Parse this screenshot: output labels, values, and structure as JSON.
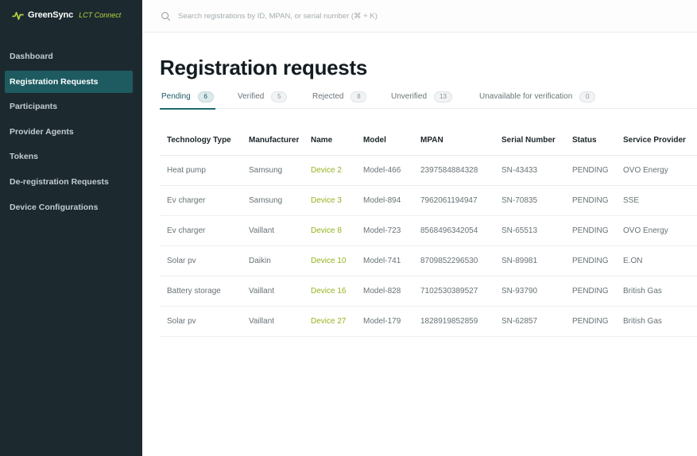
{
  "brand": {
    "name": "GreenSync",
    "product": "LCT Connect",
    "accent": "#b9d33b"
  },
  "sidebar": {
    "items": [
      {
        "label": "Dashboard",
        "active": false
      },
      {
        "label": "Registration Requests",
        "active": true
      },
      {
        "label": "Participants",
        "active": false
      },
      {
        "label": "Provider Agents",
        "active": false
      },
      {
        "label": "Tokens",
        "active": false
      },
      {
        "label": "De-registration Requests",
        "active": false
      },
      {
        "label": "Device Configurations",
        "active": false
      }
    ]
  },
  "search": {
    "placeholder": "Search registrations by ID, MPAN, or serial number (⌘ + K)",
    "value": "",
    "icon": "search-icon"
  },
  "page": {
    "title": "Registration requests"
  },
  "tabs": [
    {
      "label": "Pending",
      "count": "6",
      "active": true
    },
    {
      "label": "Verified",
      "count": "5",
      "active": false
    },
    {
      "label": "Rejected",
      "count": "8",
      "active": false
    },
    {
      "label": "Unverified",
      "count": "13",
      "active": false
    },
    {
      "label": "Unavailable for verification",
      "count": "0",
      "active": false
    }
  ],
  "table": {
    "headers": [
      "Technology Type",
      "Manufacturer",
      "Name",
      "Model",
      "MPAN",
      "Serial Number",
      "Status",
      "Service Provider"
    ],
    "rows": [
      [
        "Heat pump",
        "Samsung",
        "Device 2",
        "Model-466",
        "2397584884328",
        "SN-43433",
        "PENDING",
        "OVO Energy"
      ],
      [
        "Ev charger",
        "Samsung",
        "Device 3",
        "Model-894",
        "7962061194947",
        "SN-70835",
        "PENDING",
        "SSE"
      ],
      [
        "Ev charger",
        "Vaillant",
        "Device 8",
        "Model-723",
        "8568496342054",
        "SN-65513",
        "PENDING",
        "OVO Energy"
      ],
      [
        "Solar pv",
        "Daikin",
        "Device 10",
        "Model-741",
        "8709852296530",
        "SN-89981",
        "PENDING",
        "E.ON"
      ],
      [
        "Battery storage",
        "Vaillant",
        "Device 16",
        "Model-828",
        "7102530389527",
        "SN-93790",
        "PENDING",
        "British Gas"
      ],
      [
        "Solar pv",
        "Vaillant",
        "Device 27",
        "Model-179",
        "1828919852859",
        "SN-62857",
        "PENDING",
        "British Gas"
      ]
    ]
  },
  "colors": {
    "sidebar_bg": "#1c2a30",
    "active_nav": "#1d5b61",
    "link_green": "#93b31f"
  }
}
